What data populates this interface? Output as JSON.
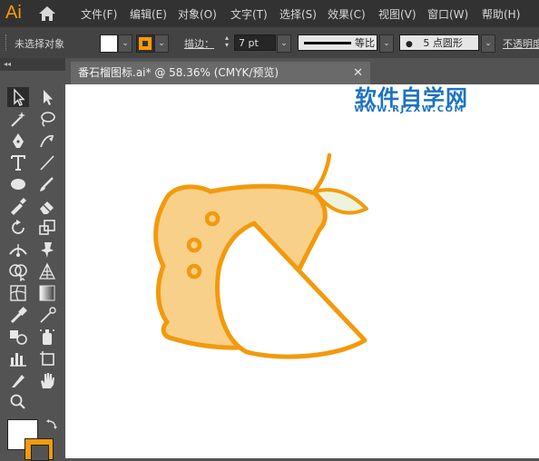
{
  "app": {
    "logo": "Ai"
  },
  "menubar": {
    "items": [
      "文件(F)",
      "编辑(E)",
      "对象(O)",
      "文字(T)",
      "选择(S)",
      "效果(C)",
      "视图(V)",
      "窗口(W)",
      "帮助(H)"
    ]
  },
  "control_bar": {
    "selection_status": "未选择对象",
    "stroke_label": "描边：",
    "stroke_weight": "7 pt",
    "stroke_profile": "等比",
    "brush_label": "5 点圆形",
    "opacity_label": "不透明度",
    "fill_color": "#ffffff",
    "stroke_color": "#ff9a00"
  },
  "toolbar": {
    "collapse": "◂◂"
  },
  "document": {
    "tab_title": "番石榴图标.ai* @ 58.36% (CMYK/预览)",
    "close": "✕"
  },
  "watermark": {
    "title": "软件自学网",
    "url": "WWW.RJZXW.COM"
  },
  "artwork": {
    "stroke_color": "#f29a0c",
    "fruit_fill": "#f9d08a",
    "slice_fill": "#ffffff",
    "leaf_fill": "#eef3dd"
  }
}
